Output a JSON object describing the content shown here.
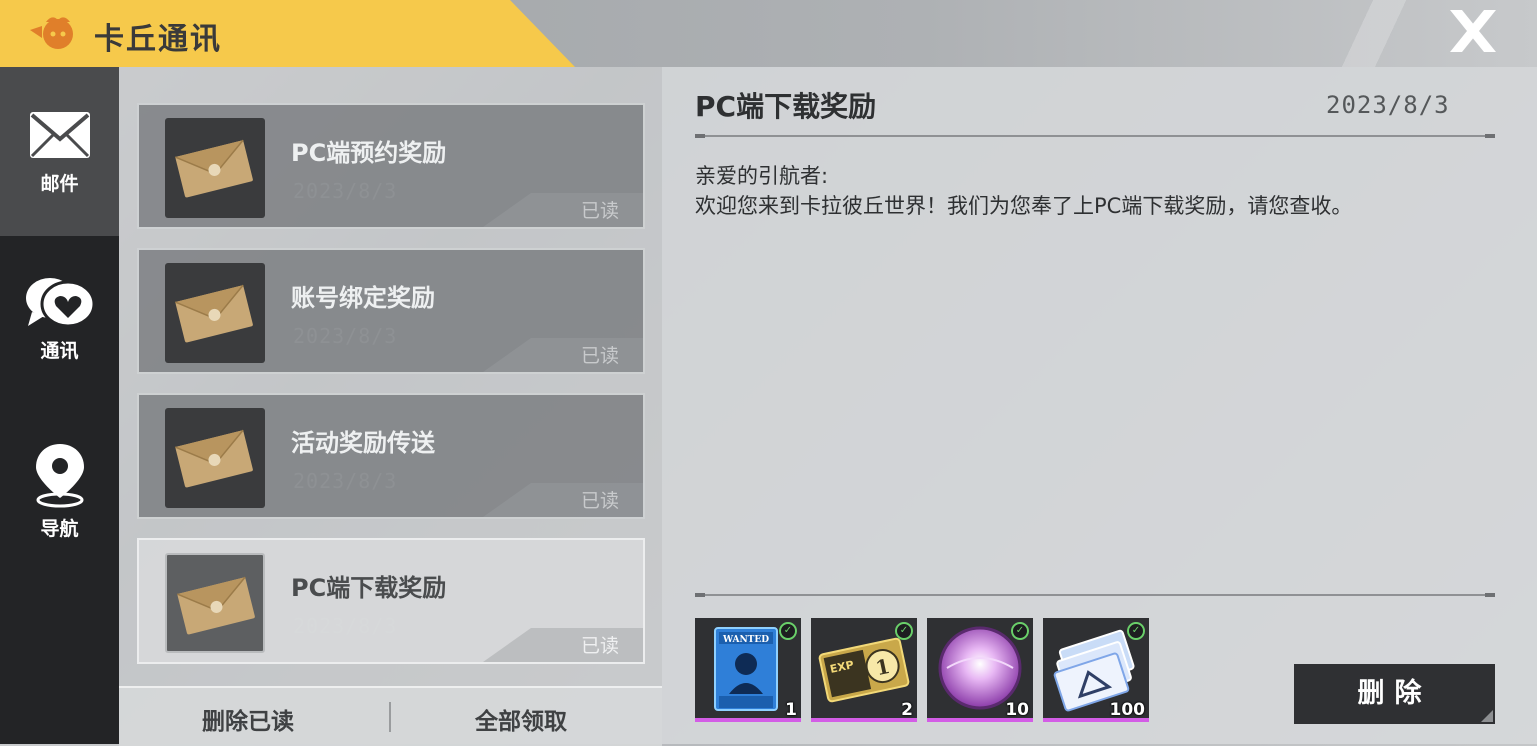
{
  "header": {
    "title": "卡丘通讯",
    "logo_icon": "kaqiu-mascot-icon",
    "close_icon": "close-x-icon"
  },
  "sidebar": {
    "items": [
      {
        "label": "邮件",
        "icon": "envelope-icon",
        "active": true
      },
      {
        "label": "通讯",
        "icon": "chat-heart-icon",
        "active": false
      },
      {
        "label": "导航",
        "icon": "map-pin-icon",
        "active": false
      }
    ]
  },
  "mail_list": {
    "items": [
      {
        "title": "PC端预约奖励",
        "date": "2023/8/3",
        "status": "已读",
        "selected": false
      },
      {
        "title": "账号绑定奖励",
        "date": "2023/8/3",
        "status": "已读",
        "selected": false
      },
      {
        "title": "活动奖励传送",
        "date": "2023/8/3",
        "status": "已读",
        "selected": false
      },
      {
        "title": "PC端下载奖励",
        "date": "2023/8/3",
        "status": "已读",
        "selected": true
      }
    ],
    "delete_read_label": "删除已读",
    "claim_all_label": "全部领取"
  },
  "detail": {
    "title": "PC端下载奖励",
    "date": "2023/8/3",
    "greeting": "亲爱的引航者:",
    "body": "欢迎您来到卡拉彼丘世界！我们为您奉了上PC端下载奖励，请您查收。",
    "rewards": [
      {
        "name": "wanted-poster",
        "quantity": "1",
        "claimed": true
      },
      {
        "name": "exp-card",
        "quantity": "2",
        "claimed": true
      },
      {
        "name": "purple-orb",
        "quantity": "10",
        "claimed": true
      },
      {
        "name": "blue-tickets",
        "quantity": "100",
        "claimed": true
      }
    ],
    "delete_label": "删除"
  },
  "colors": {
    "accent": "#f6c94b",
    "sidebar": "#232426",
    "reward_bar": "#d35de6",
    "check": "#6ad06a"
  }
}
